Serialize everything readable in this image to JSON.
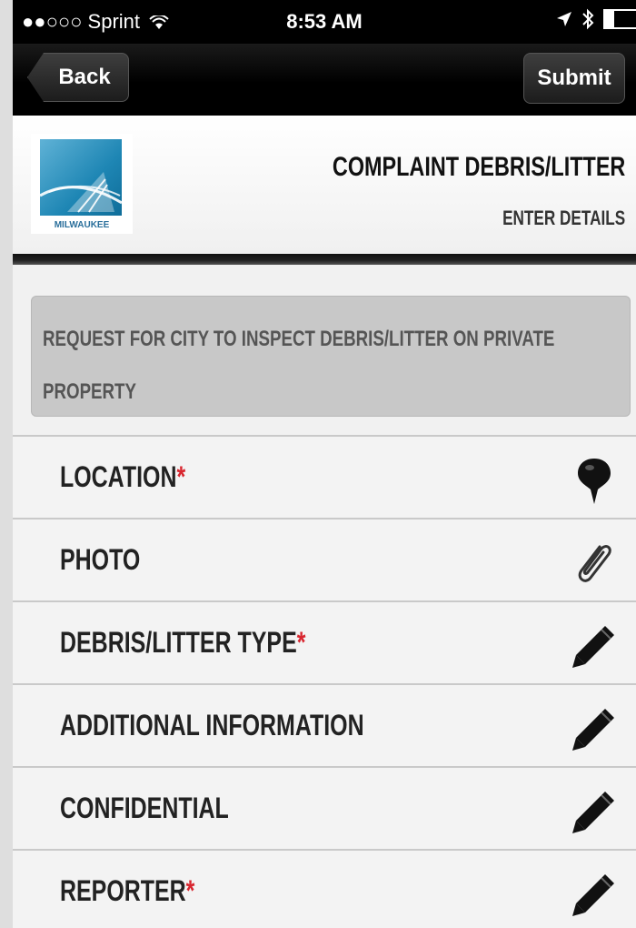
{
  "status_bar": {
    "carrier": "●●○○○ Sprint",
    "time": "8:53 AM"
  },
  "nav": {
    "back_label": "Back",
    "submit_label": "Submit"
  },
  "header": {
    "logo_text": "MILWAUKEE",
    "title": "COMPLAINT DEBRIS/LITTER",
    "subtitle": "ENTER DETAILS"
  },
  "description": "REQUEST FOR CITY TO INSPECT DEBRIS/LITTER ON PRIVATE PROPERTY",
  "required_mark": "*",
  "fields": [
    {
      "label": "LOCATION",
      "required": true,
      "icon": "map-pin-icon"
    },
    {
      "label": "PHOTO",
      "required": false,
      "icon": "paperclip-icon"
    },
    {
      "label": "DEBRIS/LITTER TYPE",
      "required": true,
      "icon": "pencil-icon"
    },
    {
      "label": "ADDITIONAL INFORMATION",
      "required": false,
      "icon": "pencil-icon"
    },
    {
      "label": "CONFIDENTIAL",
      "required": false,
      "icon": "pencil-icon"
    },
    {
      "label": "REPORTER",
      "required": true,
      "icon": "pencil-icon"
    }
  ],
  "colors": {
    "required": "#d8262f",
    "nav_bg": "#000000",
    "description_bg": "#c8c8c8"
  }
}
